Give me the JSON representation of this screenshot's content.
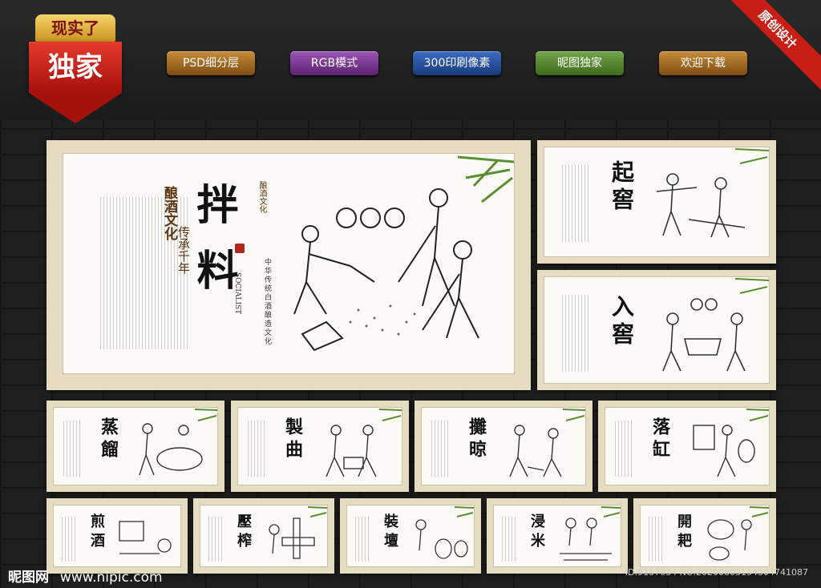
{
  "badge": {
    "top": "现实了",
    "main": "独家"
  },
  "corner_ribbon": "原创设计",
  "pills": [
    "PSD细分层",
    "RGB模式",
    "300印刷像素",
    "昵图独家",
    "欢迎下载"
  ],
  "main_panel": {
    "title_chars": [
      "拌",
      "料"
    ],
    "side_title": "酿酒文化",
    "side_sub": "传承千年",
    "small_tag": "酿酒文化",
    "socialist": "SOCIALIST",
    "vertical_caption": "中华传统白酒酿造文化"
  },
  "right_panels": [
    {
      "title": "起窖"
    },
    {
      "title": "入窖"
    }
  ],
  "row_panels": [
    {
      "title": "蒸餾"
    },
    {
      "title": "製曲"
    },
    {
      "title": "攤晾"
    },
    {
      "title": "落缸"
    }
  ],
  "bottom_panels": [
    {
      "title": "煎酒"
    },
    {
      "title": "壓榨"
    },
    {
      "title": "裝壇"
    },
    {
      "title": "浸米"
    },
    {
      "title": "開耙"
    }
  ],
  "footer": {
    "logo": "昵图网",
    "url": "www.nipic.com",
    "id_text": "ID:9157034 NO:20200803154304741087"
  }
}
